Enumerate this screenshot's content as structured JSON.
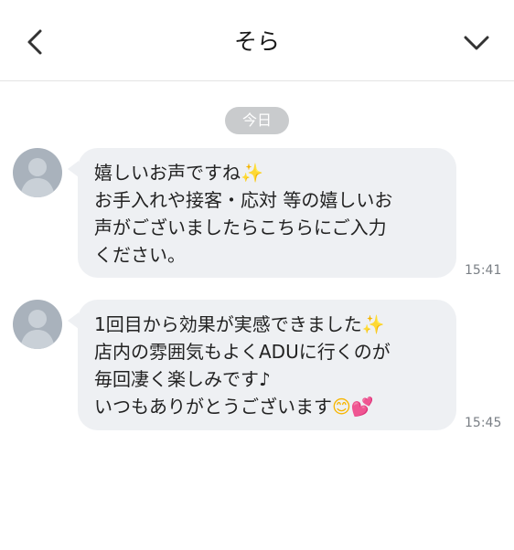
{
  "header": {
    "title": "そら",
    "back_icon": "chevron-left-icon",
    "menu_icon": "chevron-down-icon"
  },
  "date_separator": "今日",
  "messages": [
    {
      "lines": [
        "嬉しいお声ですね",
        "お手入れや接客・応対 等の嬉しいお",
        "声がございましたらこちらにご入力",
        "ください。"
      ],
      "line1_emoji": "✨",
      "time": "15:41"
    },
    {
      "lines": [
        "1回目から効果が実感できました",
        "店内の雰囲気もよくADUに行くのが",
        "毎回凄く楽しみです♪",
        "いつもありがとうございます"
      ],
      "line1_emoji": "✨",
      "line4_emoji_1": "😊",
      "line4_emoji_2": "💕",
      "time": "15:45"
    }
  ],
  "colors": {
    "bubble": "#eef0f3",
    "date_pill": "#c9cbcd",
    "time_text": "#7a7f85"
  }
}
